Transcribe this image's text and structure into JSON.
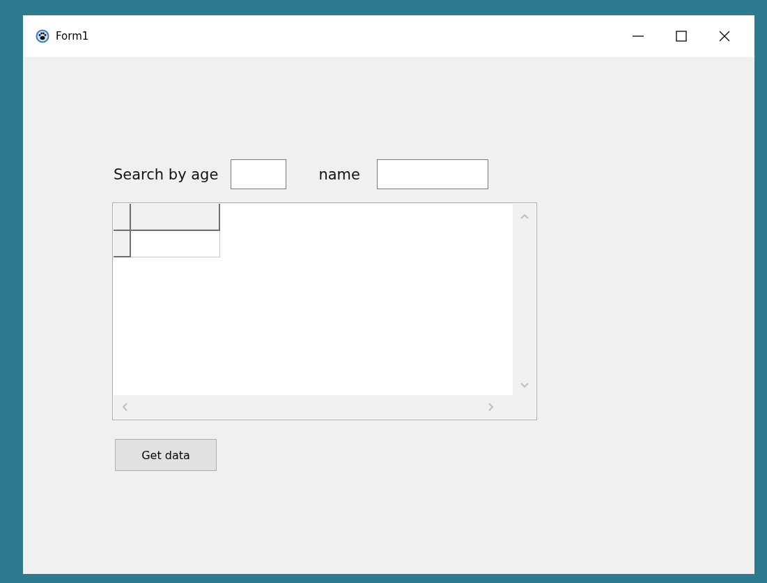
{
  "window": {
    "title": "Form1"
  },
  "search": {
    "label": "Search by age",
    "name_label": "name"
  },
  "buttons": [
    {
      "label": "Get data"
    }
  ]
}
